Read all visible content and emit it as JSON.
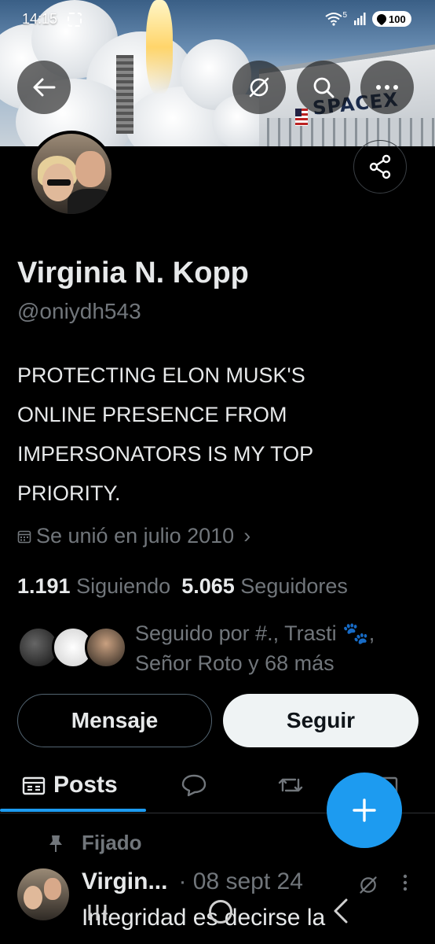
{
  "status_bar": {
    "time": "14:15",
    "network": "5",
    "battery": "100"
  },
  "banner": {
    "logo_text": "SPACEX"
  },
  "header_icons": {
    "back": "arrow-left-icon",
    "grok": "grok-icon",
    "search": "search-icon",
    "more": "more-horizontal-icon",
    "share": "share-icon"
  },
  "profile": {
    "name": "Virginia N. Kopp",
    "handle": "@oniydh543",
    "bio_lines": [
      "PROTECTING ELON MUSK'S",
      "ONLINE PRESENCE FROM",
      "IMPERSONATORS IS MY TOP",
      "PRIORITY."
    ],
    "joined": "Se unió en julio 2010",
    "joined_chevron": "›",
    "following_count": "1.191",
    "following_label": "Siguiendo",
    "followers_count": "5.065",
    "followers_label": "Seguidores",
    "followed_by_line1": "Seguido por #., Trasti 🐾,",
    "followed_by_line2": "Señor Roto y 68 más"
  },
  "actions": {
    "message": "Mensaje",
    "follow": "Seguir"
  },
  "tabs": {
    "posts": "Posts"
  },
  "pinned": {
    "label": "Fijado",
    "author": "Virgin...",
    "date": "· 08 sept 24",
    "text": "Integridad es decirse la"
  },
  "colors": {
    "accent": "#1d9bf0",
    "background": "#000000",
    "secondary_text": "#71767b"
  }
}
